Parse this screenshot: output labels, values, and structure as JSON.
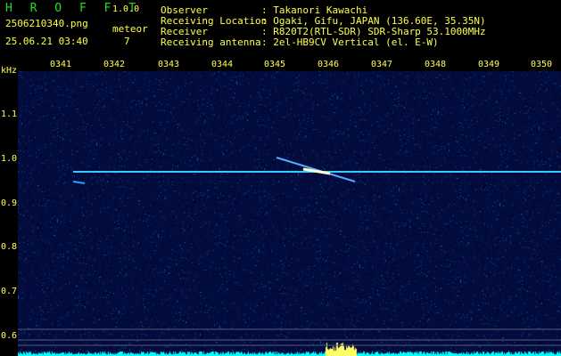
{
  "header": {
    "app_name": "H R O F F T",
    "version": "1.0.0",
    "filename": "2506210340.png",
    "datetime": "25.06.21 03:40",
    "meteor_label": "meteor",
    "meteor_count": "7",
    "info": [
      {
        "label": "Observer",
        "value": ": Takanori Kawachi"
      },
      {
        "label": "Receiving Location",
        "value": ": Ogaki, Gifu, JAPAN (136.60E, 35.35N)"
      },
      {
        "label": "Receiver",
        "value": ": R820T2(RTL-SDR) SDR-Sharp 53.1000MHz"
      },
      {
        "label": "Receiving antenna",
        "value": ": 2el-HB9CV Vertical (el. E-W)"
      }
    ]
  },
  "axis": {
    "y_unit": "kHz",
    "y_ticks": [
      "1.1",
      "1.0",
      "0.9",
      "0.8",
      "0.7",
      "0.6"
    ],
    "x_ticks": [
      "0341",
      "0342",
      "0343",
      "0344",
      "0345",
      "0346",
      "0347",
      "0348",
      "0349",
      "0350"
    ]
  },
  "colors": {
    "header_text": "#ffff44",
    "brand_text": "#22dd22",
    "background_spectrum": "#03052c",
    "carrier_line": "#33ccff",
    "meteor_echo": "#ffff66",
    "noise_floor": "#00ffff"
  }
}
